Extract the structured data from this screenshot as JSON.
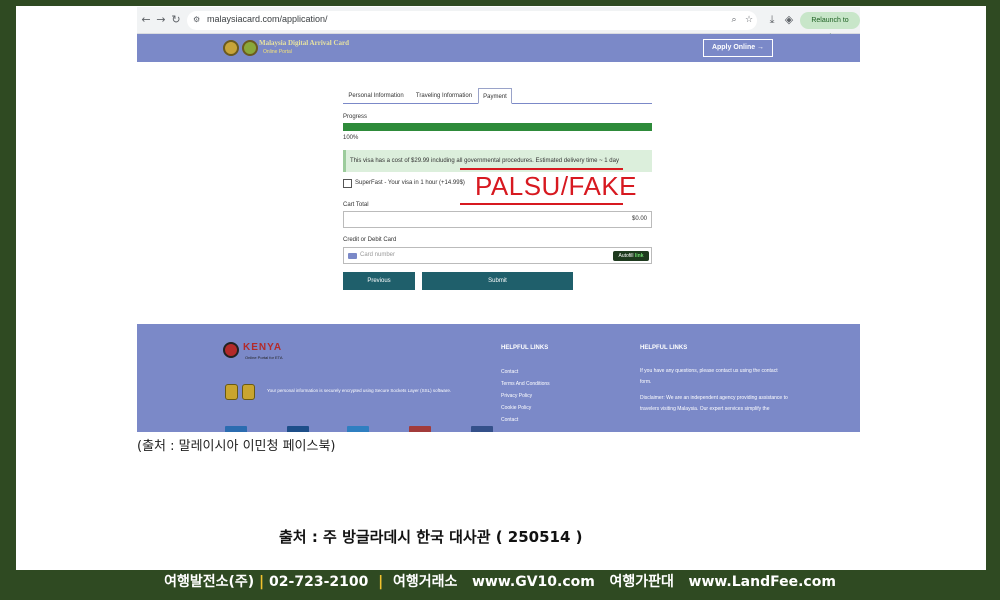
{
  "browser": {
    "url": "malaysiacard.com/application/",
    "relaunch_label": "Relaunch to update"
  },
  "site": {
    "title": "Malaysia Digital Arrival Card",
    "subtitle": "Online Portal",
    "apply_label": "Apply Online →",
    "header_color": "#7b89c8"
  },
  "form": {
    "tabs": [
      {
        "label": "Personal Information",
        "active": false
      },
      {
        "label": "Traveling Information",
        "active": false
      },
      {
        "label": "Payment",
        "active": true
      }
    ],
    "progress_label": "Progress",
    "progress_percent_text": "100%",
    "progress_fraction": 1.0,
    "notice": "This visa has a cost of $29.99 including all governmental procedures. Estimated delivery time ~ 1 day",
    "superfast_label": "SuperFast - Your visa in 1 hour (+14.99$)",
    "cart_total_label": "Cart Total",
    "cart_total_value": "$0.00",
    "card_label": "Credit or Debit Card",
    "card_placeholder": "Card number",
    "autofill_prefix": "Autofill",
    "autofill_link": "link",
    "previous_label": "Previous",
    "submit_label": "Submit",
    "button_color": "#1f5f6b"
  },
  "stamp": {
    "text": "PALSU/FAKE",
    "color": "#d71920"
  },
  "footer": {
    "kenya_title": "KENYA",
    "kenya_subtitle": "Online Portal for ETA",
    "ssl_text": "Your personal information is securely encrypted using Secure Sockets Layer (SSL) software.",
    "col1_heading": "HELPFUL LINKS",
    "links": [
      "Contact",
      "Terms And Conditions",
      "Privacy Policy",
      "Cookie Policy",
      "Contact"
    ],
    "col2_heading": "HELPFUL LINKS",
    "contact_text": "If you have any questions, please contact us using the contact form.",
    "disclaimer": "Disclaimer: We are an independent agency providing assistance to travelers visiting Malaysia. Our expert services simplify the"
  },
  "captions": {
    "source_1": "(출처 : 말레이시아 이민청 페이스북)",
    "source_2": "출처 : 주 방글라데시 한국 대사관 ( 250514 )"
  },
  "bottom_bar": {
    "company": "여행발전소(주)",
    "phone": "02-723-2100",
    "exchange": "여행거래소",
    "site1": "www.GV10.com",
    "market": "여행가판대",
    "site2": "www.LandFee.com",
    "separator": "|",
    "accent_color": "#f2c22e"
  }
}
